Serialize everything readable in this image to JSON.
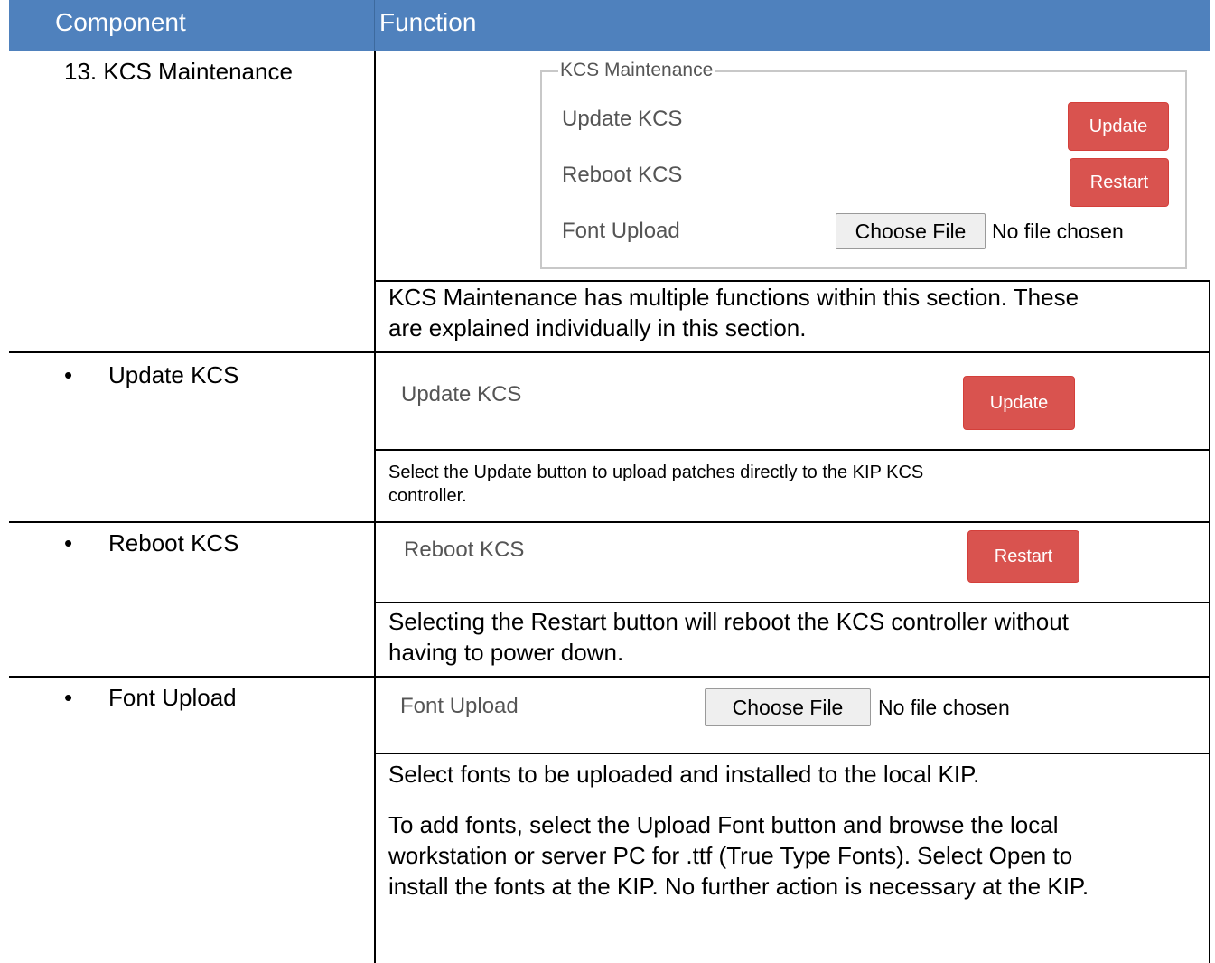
{
  "header": {
    "component": "Component",
    "function": "Function"
  },
  "rows": {
    "kcs_maintenance": {
      "component": "13. KCS Maintenance",
      "panel": {
        "legend": "KCS Maintenance",
        "update_label": "Update KCS",
        "update_button": "Update",
        "reboot_label": "Reboot KCS",
        "restart_button": "Restart",
        "font_label": "Font Upload",
        "choose_file": "Choose File",
        "no_file": "No file chosen"
      },
      "description": [
        "KCS Maintenance has multiple functions within this section. These",
        "are explained individually in this section."
      ]
    },
    "update_kcs": {
      "bullet": "•",
      "component": "Update KCS",
      "label": "Update KCS",
      "button": "Update",
      "description": [
        "Select the Update button to upload patches directly to the KIP KCS",
        "controller."
      ]
    },
    "reboot_kcs": {
      "bullet": "•",
      "component": "Reboot KCS",
      "label": "Reboot KCS",
      "button": "Restart",
      "description": [
        "Selecting the Restart button will reboot the KCS controller without",
        "having to power down."
      ]
    },
    "font_upload": {
      "bullet": "•",
      "component": "Font Upload",
      "label": "Font Upload",
      "choose_file": "Choose File",
      "no_file": "No file chosen",
      "description_1": "Select fonts to be uploaded and installed to the local KIP.",
      "description_2": [
        "To add fonts, select the Upload Font button and browse the local",
        "workstation or server PC for .ttf (True Type Fonts).  Select Open to",
        "install the fonts at the KIP.  No further action is necessary at the KIP."
      ]
    }
  },
  "colors": {
    "header_bg": "#4f81bd",
    "button_red": "#d9534f",
    "label_gray": "#555555"
  }
}
